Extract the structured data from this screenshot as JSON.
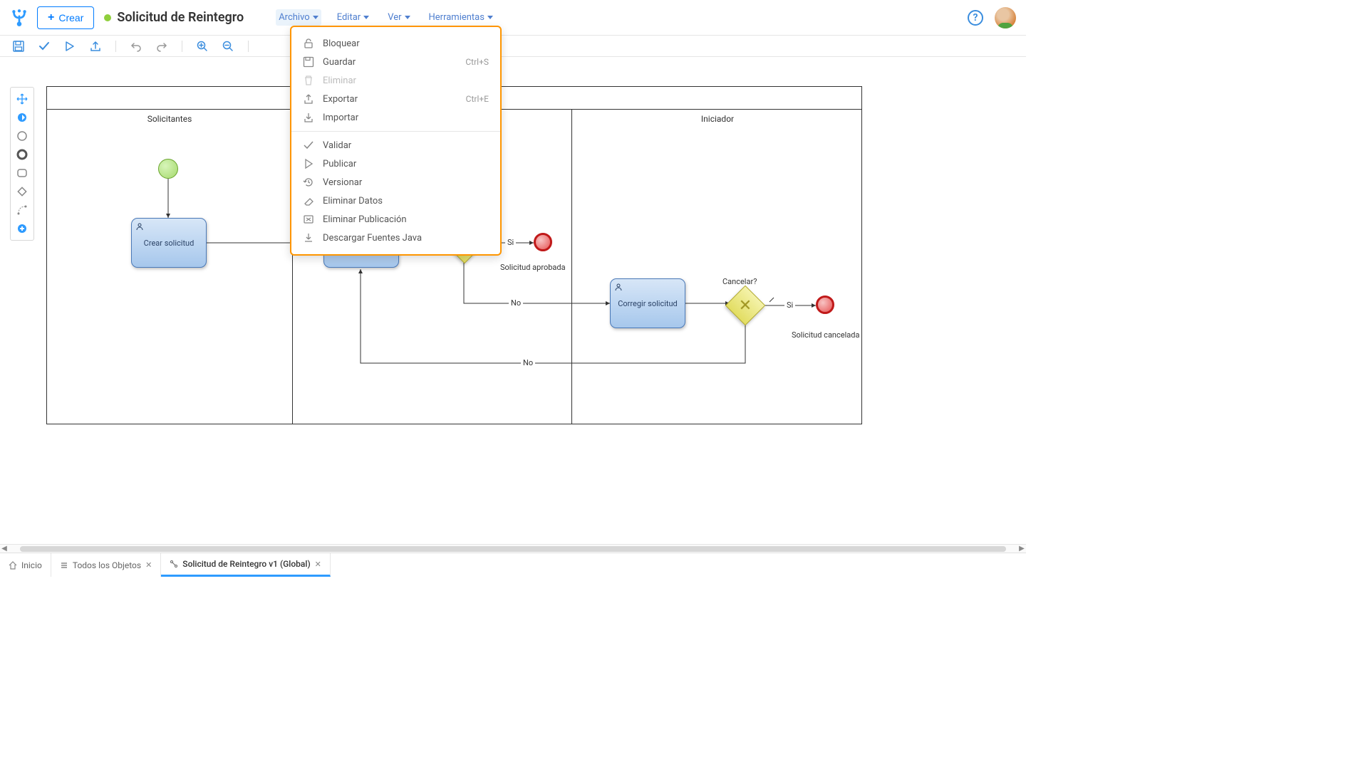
{
  "header": {
    "create_label": "Crear",
    "title": "Solicitud de Reintegro"
  },
  "menus": {
    "file": "Archivo",
    "edit": "Editar",
    "view": "Ver",
    "tools": "Herramientas"
  },
  "file_menu": {
    "lock": "Bloquear",
    "save": "Guardar",
    "save_shortcut": "Ctrl+S",
    "delete": "Eliminar",
    "export": "Exportar",
    "export_shortcut": "Ctrl+E",
    "import": "Importar",
    "validate": "Validar",
    "publish": "Publicar",
    "version": "Versionar",
    "delete_data": "Eliminar Datos",
    "unpublish": "Eliminar Publicación",
    "download_java": "Descargar Fuentes Java"
  },
  "diagram": {
    "lane1": "Solicitantes",
    "lane3": "Iniciador",
    "task_create": "Crear solicitud",
    "task_correct": "Corregir solicitud",
    "gateway2_label": "Cancelar?",
    "end1_label": "Solicitud aprobada",
    "end2_label": "Solicitud cancelada",
    "edge_yes": "Si",
    "edge_no": "No"
  },
  "tabs": {
    "home": "Inicio",
    "all_objects": "Todos los Objetos",
    "current": "Solicitud de Reintegro v1 (Global)"
  }
}
